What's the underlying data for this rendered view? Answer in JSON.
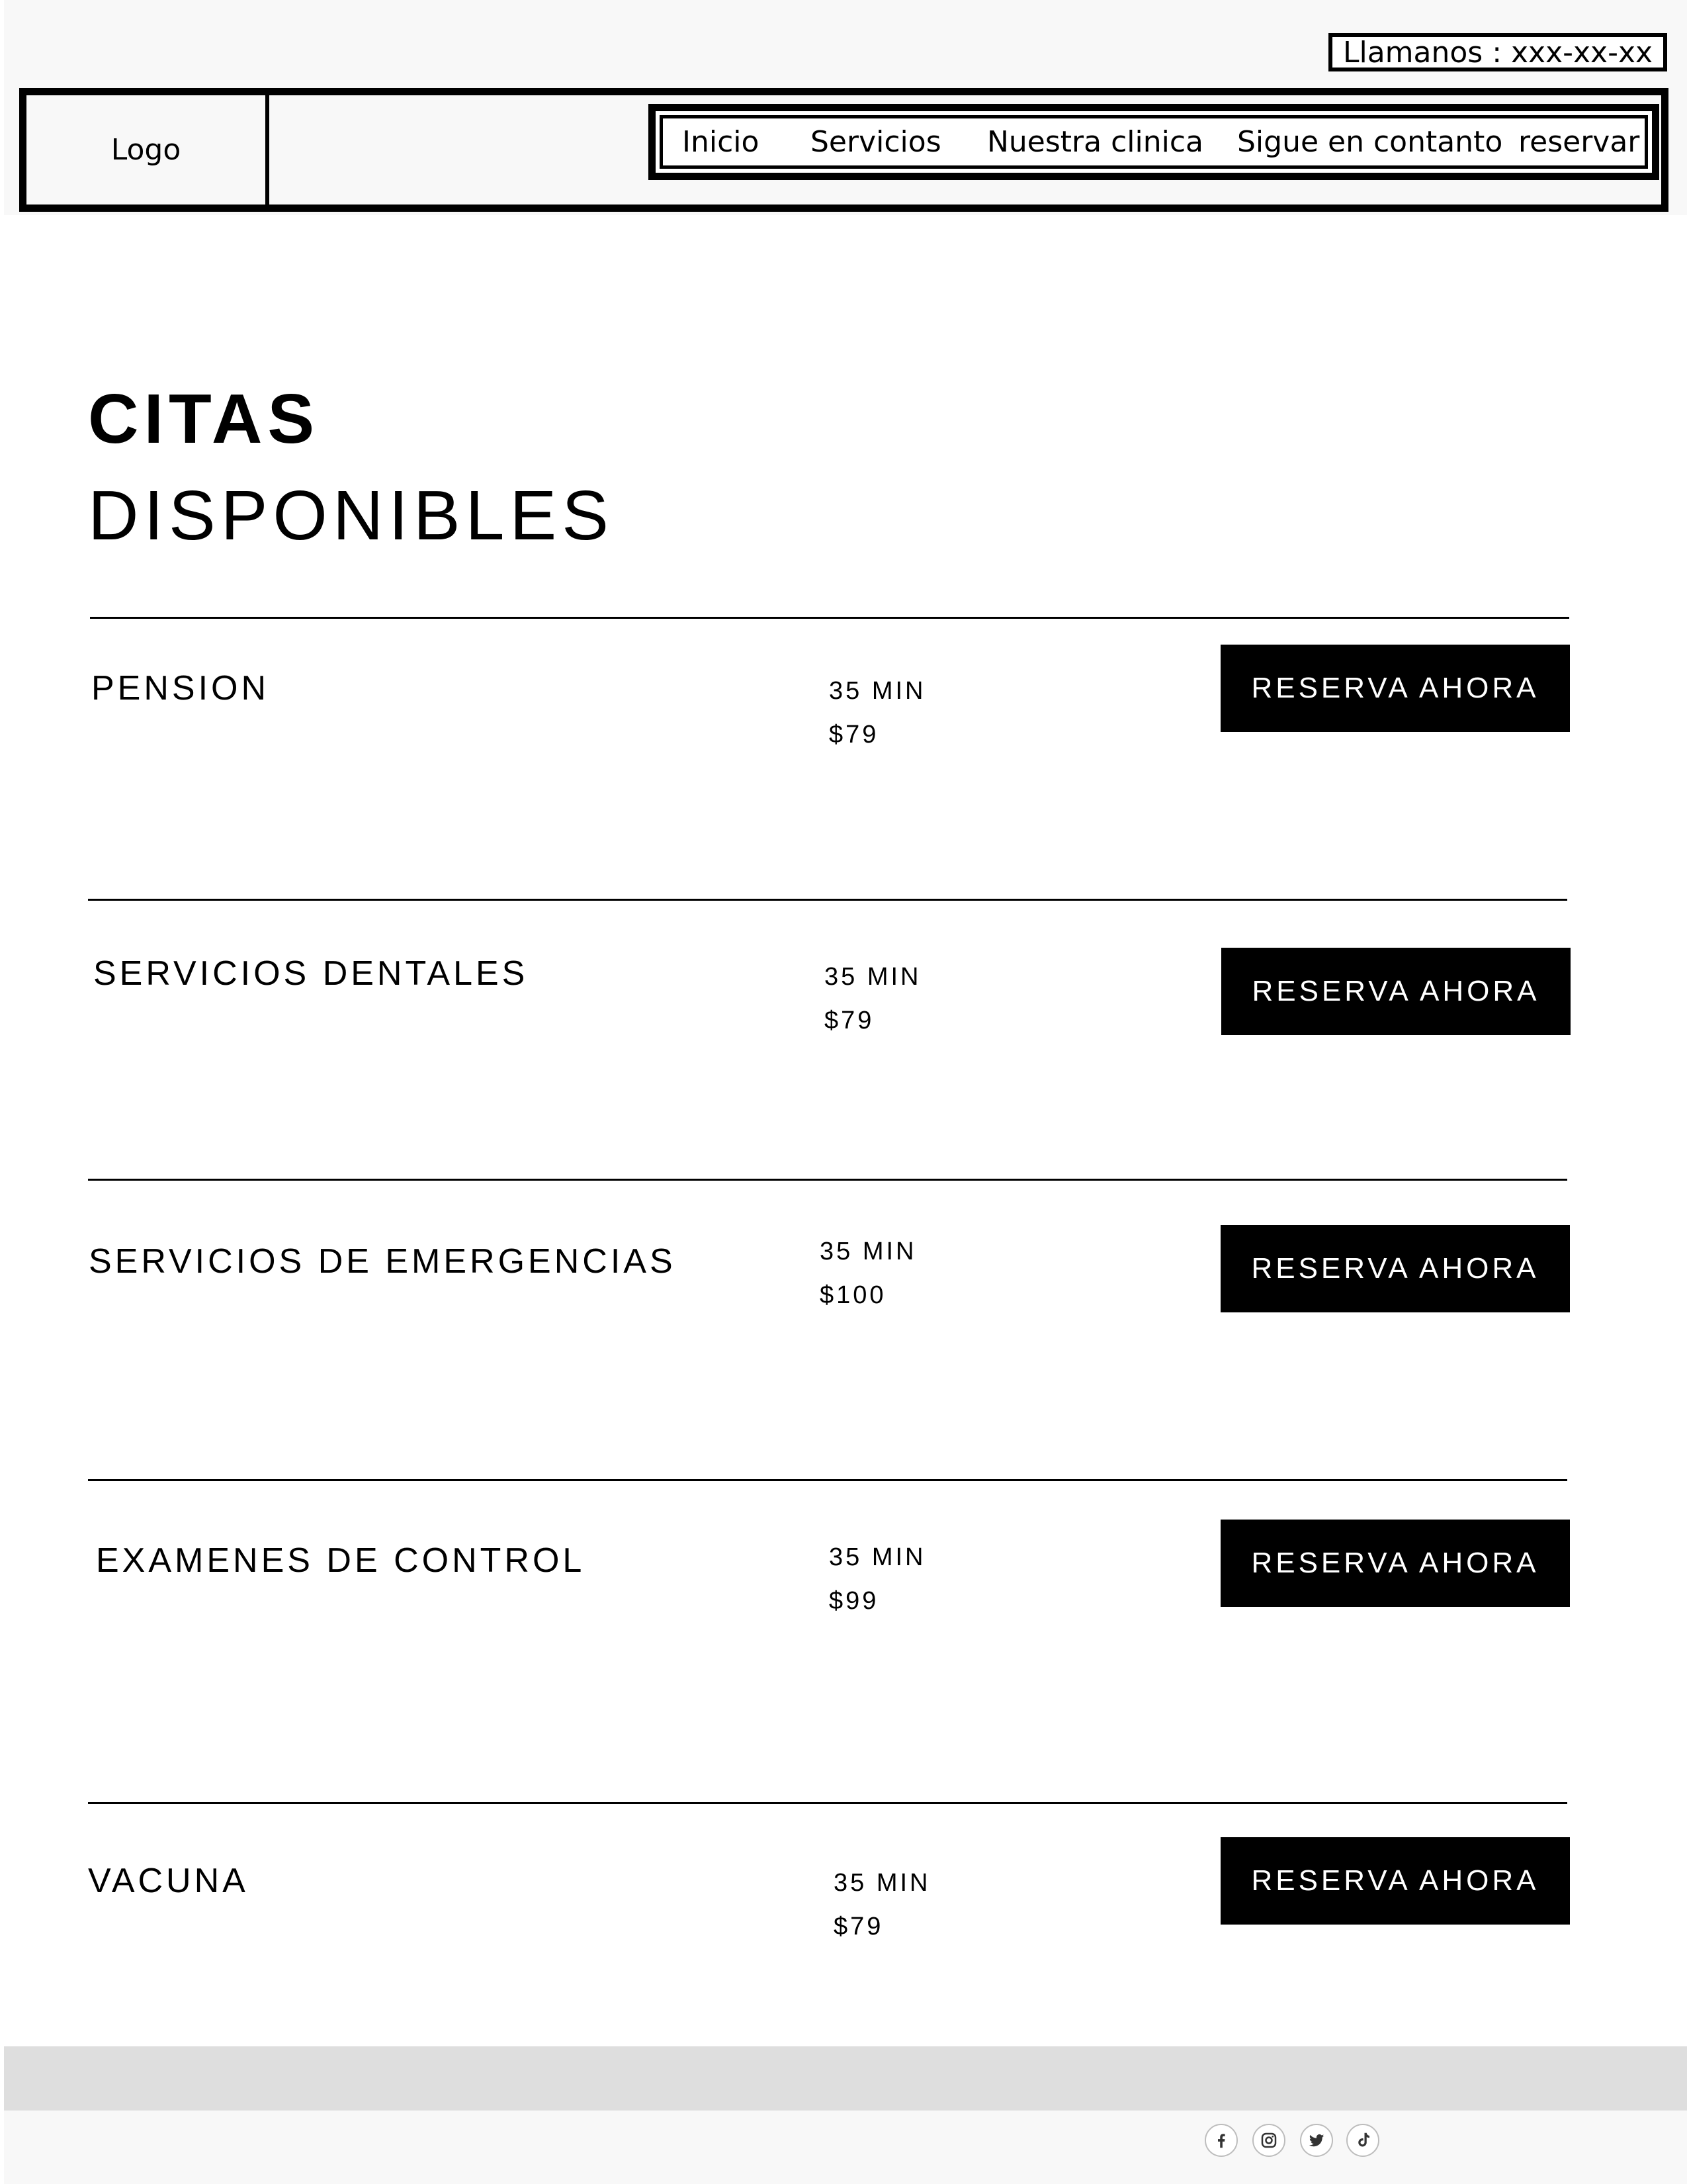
{
  "header": {
    "phone": "Llamanos : xxx-xx-xx",
    "logo": "Logo",
    "nav": [
      "Inicio",
      "Servicios",
      "Nuestra clinica",
      "Sigue en contanto",
      "reservar"
    ]
  },
  "main": {
    "title_bold": "CITAS",
    "title_light": "DISPONIBLES",
    "button_label": "RESERVA AHORA",
    "services": [
      {
        "name": "PENSION",
        "duration": "35 MIN",
        "price": "$79"
      },
      {
        "name": "SERVICIOS DENTALES",
        "duration": "35 MIN",
        "price": "$79"
      },
      {
        "name": "SERVICIOS DE EMERGENCIAS",
        "duration": "35 MIN",
        "price": "$100"
      },
      {
        "name": "EXAMENES DE CONTROL",
        "duration": "35 MIN",
        "price": "$99"
      },
      {
        "name": "VACUNA",
        "duration": "35 MIN",
        "price": "$79"
      }
    ]
  },
  "footer": {
    "social_icons": [
      "facebook-icon",
      "instagram-icon",
      "twitter-icon",
      "tiktok-icon"
    ]
  },
  "colors": {
    "text": "#000000",
    "button_bg": "#000000",
    "button_text": "#ffffff",
    "header_bg": "#f8f8f8",
    "footer_bar": "#dedede"
  }
}
